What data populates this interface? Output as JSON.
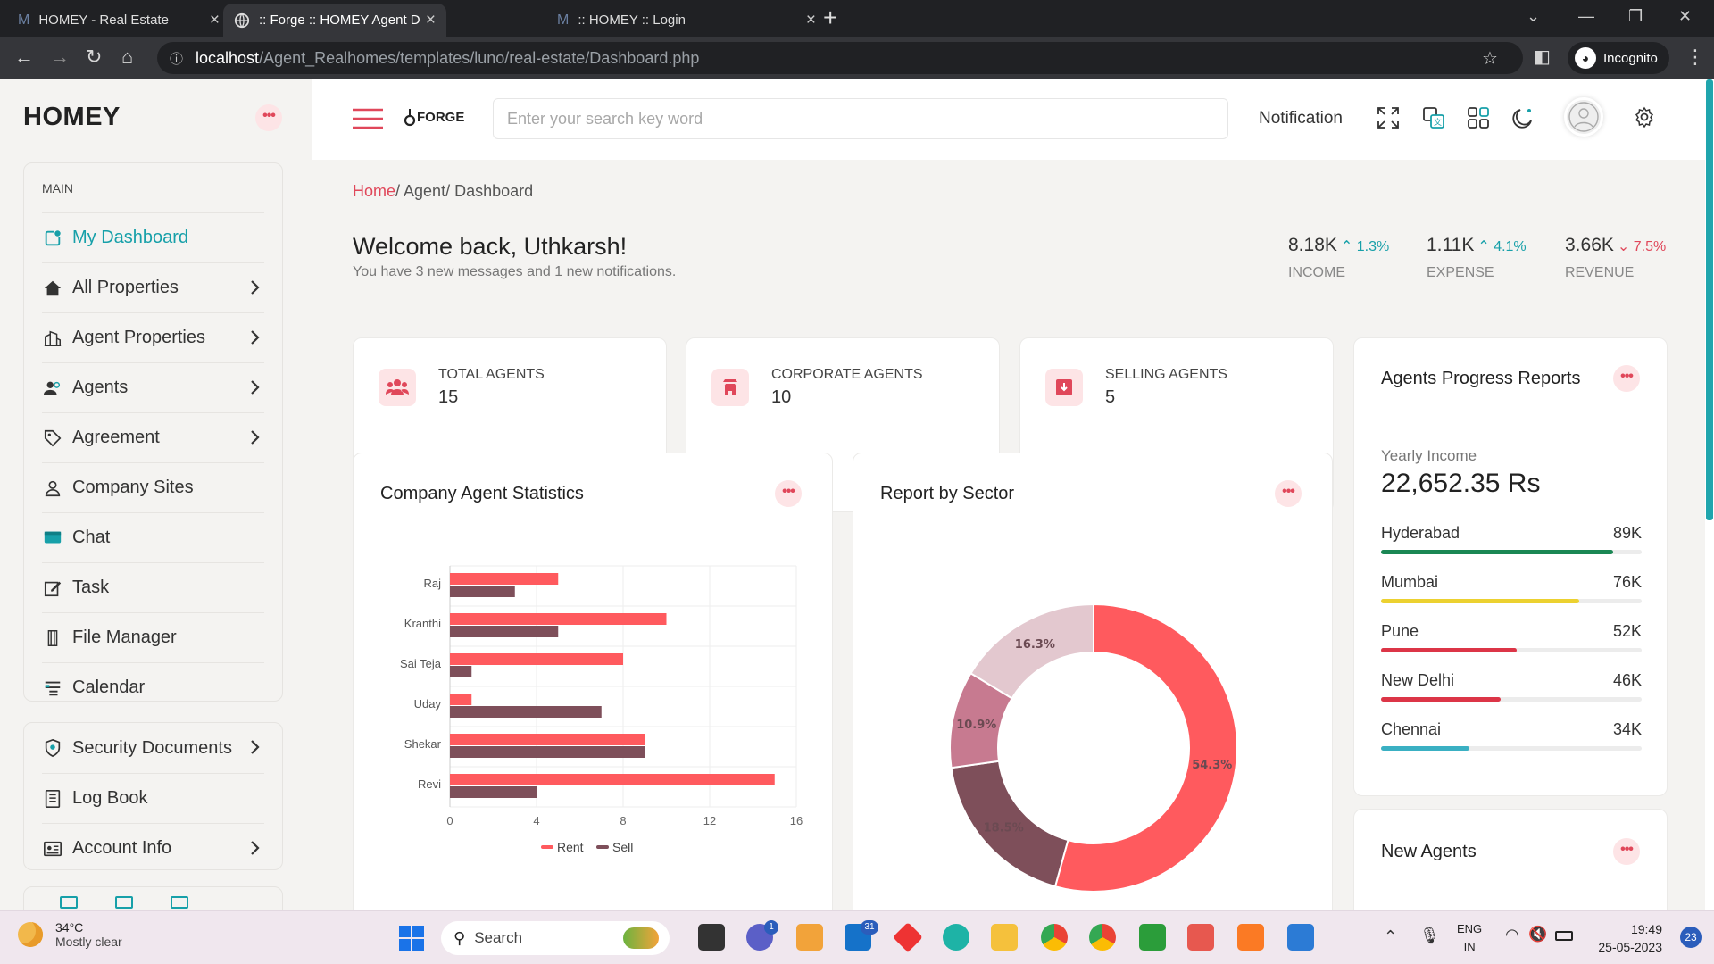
{
  "browser": {
    "tabs": [
      {
        "title": "HOMEY - Real Estate"
      },
      {
        "title": ":: Forge :: HOMEY Agent Dashboard"
      },
      {
        "title": ":: HOMEY :: Login"
      }
    ],
    "url_host": "localhost",
    "url_path": "/Agent_Realhomes/templates/luno/real-estate/Dashboard.php",
    "profile": "Incognito"
  },
  "sidebar": {
    "brand": "HOMEY",
    "section": "MAIN",
    "items": [
      {
        "label": "My Dashboard",
        "icon": "dashboard-icon",
        "active": true
      },
      {
        "label": "All Properties",
        "icon": "house-icon",
        "chevron": true
      },
      {
        "label": "Agent Properties",
        "icon": "building-icon",
        "chevron": true
      },
      {
        "label": "Agents",
        "icon": "users-icon",
        "chevron": true
      },
      {
        "label": "Agreement",
        "icon": "tag-icon",
        "chevron": true
      },
      {
        "label": "Company Sites",
        "icon": "location-user-icon"
      },
      {
        "label": "Chat",
        "icon": "chat-icon"
      },
      {
        "label": "Task",
        "icon": "edit-icon"
      },
      {
        "label": "File Manager",
        "icon": "file-icon"
      },
      {
        "label": "Calendar",
        "icon": "calendar-icon"
      }
    ],
    "items2": [
      {
        "label": "Security Documents",
        "icon": "shield-icon",
        "chevron": true
      },
      {
        "label": "Log Book",
        "icon": "book-icon"
      },
      {
        "label": "Account Info",
        "icon": "id-card-icon",
        "chevron": true
      }
    ]
  },
  "topbar": {
    "logo": "FORGE",
    "search_placeholder": "Enter your search key word",
    "notification": "Notification"
  },
  "breadcrumb": {
    "home": "Home",
    "agent": "/ Agent",
    "page": "/ Dashboard"
  },
  "welcome": {
    "title": "Welcome back, Uthkarsh!",
    "subtitle": "You have 3 new messages and 1 new notifications."
  },
  "kpis": [
    {
      "value": "8.18K",
      "change": "1.3%",
      "dir": "up",
      "label": "INCOME"
    },
    {
      "value": "1.11K",
      "change": "4.1%",
      "dir": "up",
      "label": "EXPENSE"
    },
    {
      "value": "3.66K",
      "change": "7.5%",
      "dir": "down",
      "label": "REVENUE"
    }
  ],
  "stats": [
    {
      "label": "TOTAL AGENTS",
      "value": "15"
    },
    {
      "label": "CORPORATE AGENTS",
      "value": "10"
    },
    {
      "label": "SELLING AGENTS",
      "value": "5"
    }
  ],
  "agent_stats_card": {
    "title": "Company Agent Statistics"
  },
  "sector_card": {
    "title": "Report by Sector"
  },
  "progress_card": {
    "title": "Agents Progress Reports",
    "yearly_label": "Yearly Income",
    "yearly_value": "22,652.35 Rs",
    "cities": [
      {
        "name": "Hyderabad",
        "value": "89K",
        "fraction": 0.89,
        "color": "#1a8754"
      },
      {
        "name": "Mumbai",
        "value": "76K",
        "fraction": 0.76,
        "color": "#ecd130"
      },
      {
        "name": "Pune",
        "value": "52K",
        "fraction": 0.52,
        "color": "#dc3547"
      },
      {
        "name": "New Delhi",
        "value": "46K",
        "fraction": 0.46,
        "color": "#dc3547"
      },
      {
        "name": "Chennai",
        "value": "34K",
        "fraction": 0.34,
        "color": "#3ab0c3"
      }
    ]
  },
  "new_agents_card": {
    "title": "New Agents"
  },
  "chart_data": [
    {
      "type": "bar",
      "orientation": "horizontal",
      "categories": [
        "Raj",
        "Kranthi",
        "Sai Teja",
        "Uday",
        "Shekar",
        "Revi"
      ],
      "series": [
        {
          "name": "Rent",
          "values": [
            5,
            10,
            8,
            1,
            9,
            15
          ],
          "color": "#ff5a5e"
        },
        {
          "name": "Sell",
          "values": [
            3,
            5,
            1,
            7,
            9,
            4
          ],
          "color": "#7e4f5a"
        }
      ],
      "xlim": [
        0,
        16
      ],
      "xticks": [
        0,
        4,
        8,
        12,
        16
      ],
      "legend": "bottom",
      "grid": true
    },
    {
      "type": "pie",
      "donut": true,
      "slices": [
        {
          "label": "54.3%",
          "value": 54.3,
          "color": "#ff5a5e"
        },
        {
          "label": "18.5%",
          "value": 18.5,
          "color": "#7e4f5a"
        },
        {
          "label": "10.9%",
          "value": 10.9,
          "color": "#c77a90"
        },
        {
          "label": "16.3%",
          "value": 16.3,
          "color": "#e3c8cf"
        }
      ]
    }
  ],
  "taskbar": {
    "temp": "34°C",
    "weather": "Mostly clear",
    "search": "Search",
    "lang1": "ENG",
    "lang2": "IN",
    "time": "19:49",
    "date": "25-05-2023",
    "notif_count": "23",
    "chat_badge": "1",
    "mail_badge": "31"
  }
}
